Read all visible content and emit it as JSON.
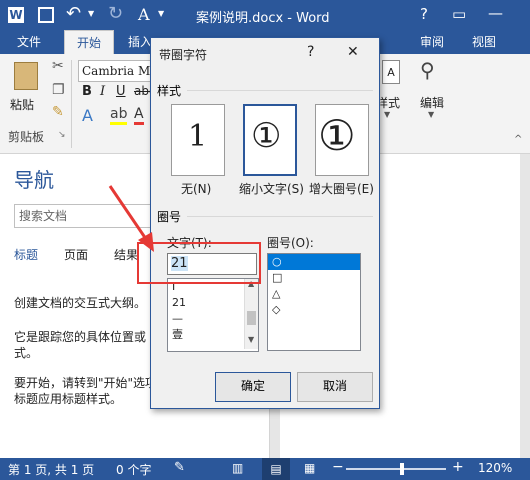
{
  "app": {
    "title": "案例说明.docx - Word",
    "window_controls": [
      "?",
      "▭",
      "—"
    ]
  },
  "tabs": [
    {
      "label": "文件",
      "active": false
    },
    {
      "label": "开始",
      "active": true
    },
    {
      "label": "插入",
      "active": false
    },
    {
      "label": "审阅",
      "active": false
    },
    {
      "label": "视图",
      "active": false
    }
  ],
  "ribbon": {
    "paste_label": "粘贴",
    "clipboard_group": "剪贴板",
    "font_name": "Cambria Ma",
    "styles_label": "样式",
    "editing_label": "编辑"
  },
  "nav": {
    "title": "导航",
    "search_placeholder": "搜索文档",
    "tabs": [
      "标题",
      "页面",
      "结果"
    ],
    "desc1": "创建文档的交互式大纲。",
    "desc2_line1": "它是跟踪您的具体位置或",
    "desc2_line2": "式。",
    "desc3_line1": "要开始，请转到\"开始\"选项",
    "desc3_line2": "标题应用标题样式。"
  },
  "dialog": {
    "title": "带圈字符",
    "help": "?",
    "close": "✕",
    "style_group": "样式",
    "style_options": [
      {
        "label": "无(N)",
        "glyph": "1"
      },
      {
        "label": "缩小文字(S)",
        "glyph": "①"
      },
      {
        "label": "增大圈号(E)",
        "glyph": "①"
      }
    ],
    "circle_group": "圈号",
    "text_label": "文字(T):",
    "text_value": "21",
    "text_list": [
      "I",
      "21",
      "—",
      "壹"
    ],
    "circle_label": "圈号(O):",
    "circle_list": [
      "○",
      "□",
      "△",
      "◇"
    ],
    "ok": "确定",
    "cancel": "取消"
  },
  "status": {
    "page": "第 1 页, 共 1 页",
    "words": "0 个字",
    "zoom": "120%",
    "zoom_minus": "−",
    "zoom_plus": "+"
  },
  "colors": {
    "word_blue": "#2b579a",
    "highlight_red": "#e53935",
    "selection": "#0078d7"
  }
}
